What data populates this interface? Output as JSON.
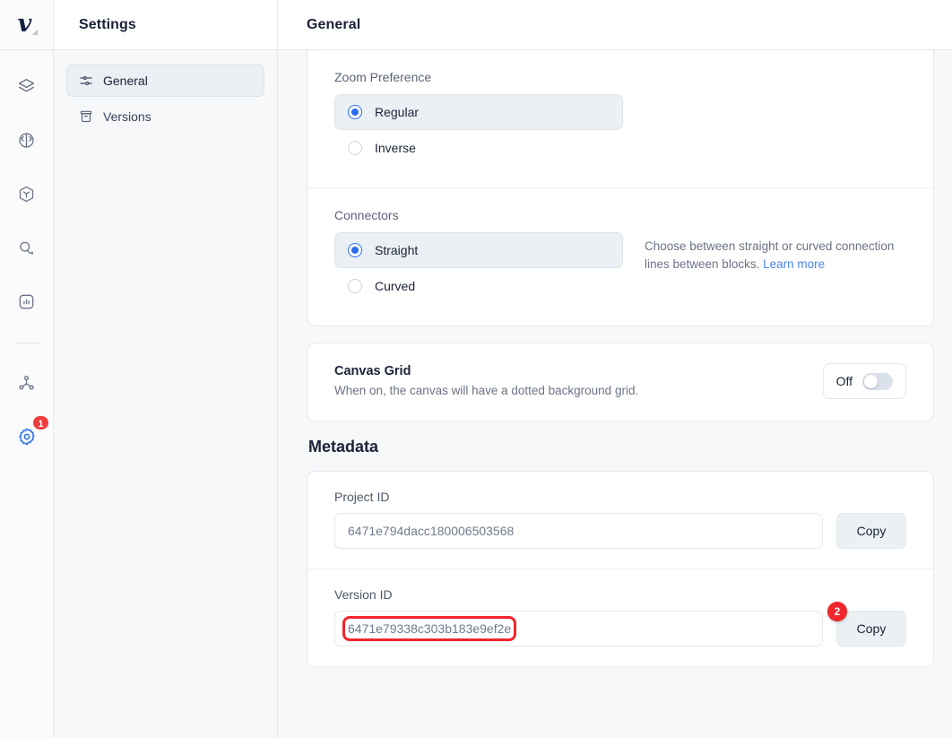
{
  "rail": {
    "logo_name": "voiceflow-logo",
    "items": [
      {
        "name": "layers-icon",
        "badge": null
      },
      {
        "name": "brain-icon",
        "badge": null
      },
      {
        "name": "cube-icon",
        "badge": null
      },
      {
        "name": "chat-icon",
        "badge": null
      },
      {
        "name": "analytics-icon",
        "badge": null
      },
      {
        "name": "share-nodes-icon",
        "badge": null
      },
      {
        "name": "gear-icon",
        "badge": "1"
      }
    ],
    "active_badge": "1",
    "active_color": "#2b6ff0",
    "badge_color": "#f03c3c"
  },
  "sidebar": {
    "title": "Settings",
    "items": [
      {
        "label": "General",
        "icon": "sliders-icon",
        "active": true
      },
      {
        "label": "Versions",
        "icon": "archive-icon",
        "active": false
      }
    ]
  },
  "header": {
    "title": "General"
  },
  "settings": {
    "zoom_preference": {
      "label": "Zoom Preference",
      "options": [
        {
          "label": "Regular",
          "selected": true
        },
        {
          "label": "Inverse",
          "selected": false
        }
      ]
    },
    "connectors": {
      "label": "Connectors",
      "options": [
        {
          "label": "Straight",
          "selected": true
        },
        {
          "label": "Curved",
          "selected": false
        }
      ],
      "help_text": "Choose between straight or curved connection lines between blocks. ",
      "help_link": "Learn more"
    },
    "canvas_grid": {
      "title": "Canvas Grid",
      "description": "When on, the canvas will have a dotted background grid.",
      "toggle_label": "Off",
      "toggle_on": false
    }
  },
  "metadata": {
    "heading": "Metadata",
    "fields": [
      {
        "label": "Project ID",
        "value": "6471e794dacc180006503568",
        "copy_label": "Copy",
        "annotated": false,
        "step_badge": null
      },
      {
        "label": "Version ID",
        "value": "6471e79338c303b183e9ef2e",
        "copy_label": "Copy",
        "annotated": true,
        "step_badge": "2"
      }
    ]
  },
  "annotation": {
    "color": "#f0262b"
  }
}
